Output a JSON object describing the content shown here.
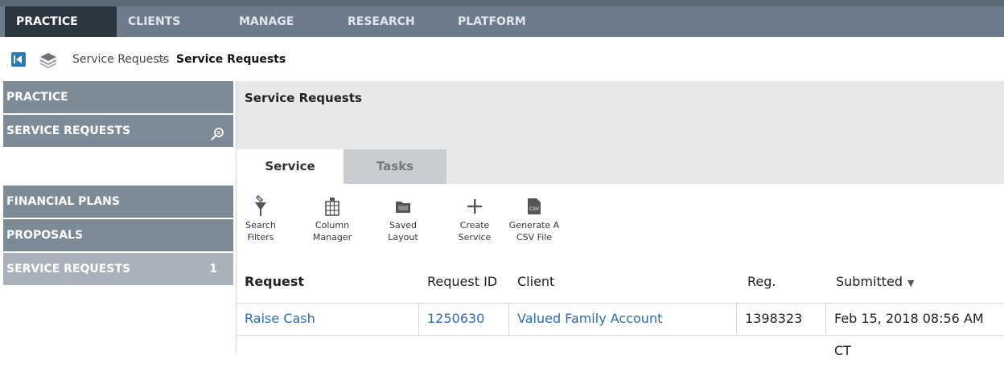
{
  "topnav": {
    "tabs": [
      {
        "label": "PRACTICE",
        "active": true
      },
      {
        "label": "CLIENTS"
      },
      {
        "label": "MANAGE"
      },
      {
        "label": "RESEARCH"
      },
      {
        "label": "PLATFORM"
      }
    ]
  },
  "breadcrumb": {
    "items": [
      "Service Requests",
      "Service Requests"
    ],
    "separator": ">"
  },
  "sidebar": {
    "top": [
      {
        "label": "PRACTICE"
      },
      {
        "label": "SERVICE REQUESTS",
        "icon": "search-icon"
      }
    ],
    "items": [
      {
        "label": "FINANCIAL PLANS"
      },
      {
        "label": "PROPOSALS"
      },
      {
        "label": "SERVICE REQUESTS",
        "count": "1",
        "selected": true
      }
    ]
  },
  "main": {
    "title": "Service Requests",
    "tabs": [
      {
        "label": "Service",
        "active": true
      },
      {
        "label": "Tasks"
      }
    ],
    "toolbar": [
      {
        "icon": "search-filter-icon",
        "line1": "Search",
        "line2": "Filters"
      },
      {
        "icon": "column-manager-icon",
        "line1": "Column",
        "line2": "Manager"
      },
      {
        "icon": "folder-icon",
        "line1": "Saved",
        "line2": "Layout"
      },
      {
        "icon": "plus-icon",
        "line1": "Create",
        "line2": "Service"
      },
      {
        "icon": "csv-file-icon",
        "line1": "Generate A",
        "line2": "CSV File",
        "icon_text": "CSV"
      }
    ],
    "table": {
      "columns": [
        {
          "label": "Request",
          "bold": true
        },
        {
          "label": "Request ID"
        },
        {
          "label": "Client"
        },
        {
          "label": "Reg."
        },
        {
          "label": "Submitted",
          "sorted": "desc"
        }
      ],
      "rows": [
        {
          "request": "Raise Cash",
          "request_id": "1250630",
          "client": "Valued Family Account",
          "reg": "1398323",
          "submitted": "Feb 15, 2018 08:56 AM CT"
        }
      ]
    }
  },
  "colors": {
    "nav_bg": "#6c7c8a",
    "nav_active": "#2b3640",
    "sidebar_bg": "#7d8b97",
    "sidebar_selected": "#a9b2ba",
    "link": "#2a6db0"
  }
}
